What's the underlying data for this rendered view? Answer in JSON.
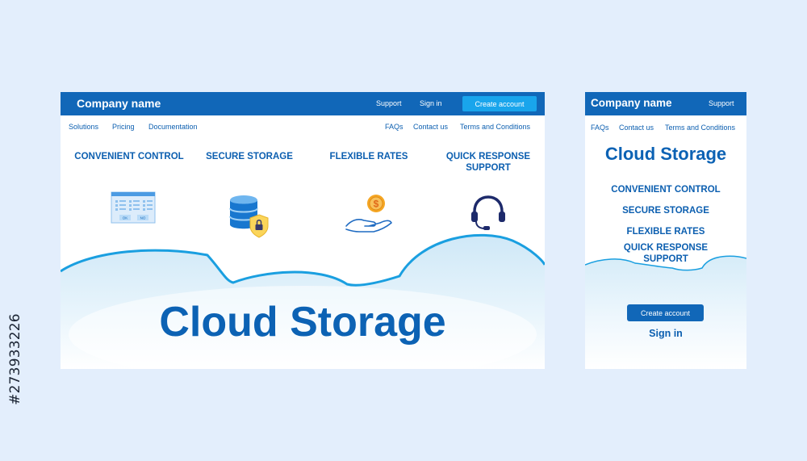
{
  "stock_id": "#273933226",
  "desktop": {
    "brand": "Company name",
    "top_links": {
      "support": "Support",
      "sign_in": "Sign in",
      "create_account": "Create account"
    },
    "nav_left": [
      "Solutions",
      "Pricing",
      "Documentation"
    ],
    "nav_right": [
      "FAQs",
      "Contact us",
      "Terms and Conditions"
    ],
    "features": [
      {
        "label": "CONVENIENT CONTROL",
        "icon": "control-panel-icon"
      },
      {
        "label": "SECURE STORAGE",
        "icon": "secure-database-icon"
      },
      {
        "label": "FLEXIBLE RATES",
        "icon": "hand-coin-icon"
      },
      {
        "label": "QUICK RESPONSE SUPPORT",
        "label_lines": [
          "QUICK RESPONSE",
          "SUPPORT"
        ],
        "icon": "headset-icon"
      }
    ],
    "panel_buttons": [
      "OK",
      "NO"
    ],
    "coin_symbol": "$",
    "hero_title": "Cloud Storage"
  },
  "mobile": {
    "brand": "Company name",
    "support": "Support",
    "nav": [
      "FAQs",
      "Contact us",
      "Terms and Conditions"
    ],
    "title": "Cloud Storage",
    "features": [
      "CONVENIENT CONTROL",
      "SECURE STORAGE",
      "FLEXIBLE RATES"
    ],
    "feature_last_lines": [
      "QUICK RESPONSE",
      "SUPPORT"
    ],
    "create_account": "Create account",
    "sign_in": "Sign in"
  },
  "colors": {
    "background": "#e3eefc",
    "header": "#1167b8",
    "accent_button": "#19a5ec",
    "text_blue": "#0c5fb0",
    "cloud_outline": "#1a9fe0",
    "cloud_fill": "#d4ebf8",
    "coin": "#f5a623",
    "shield": "#fbd55a"
  }
}
